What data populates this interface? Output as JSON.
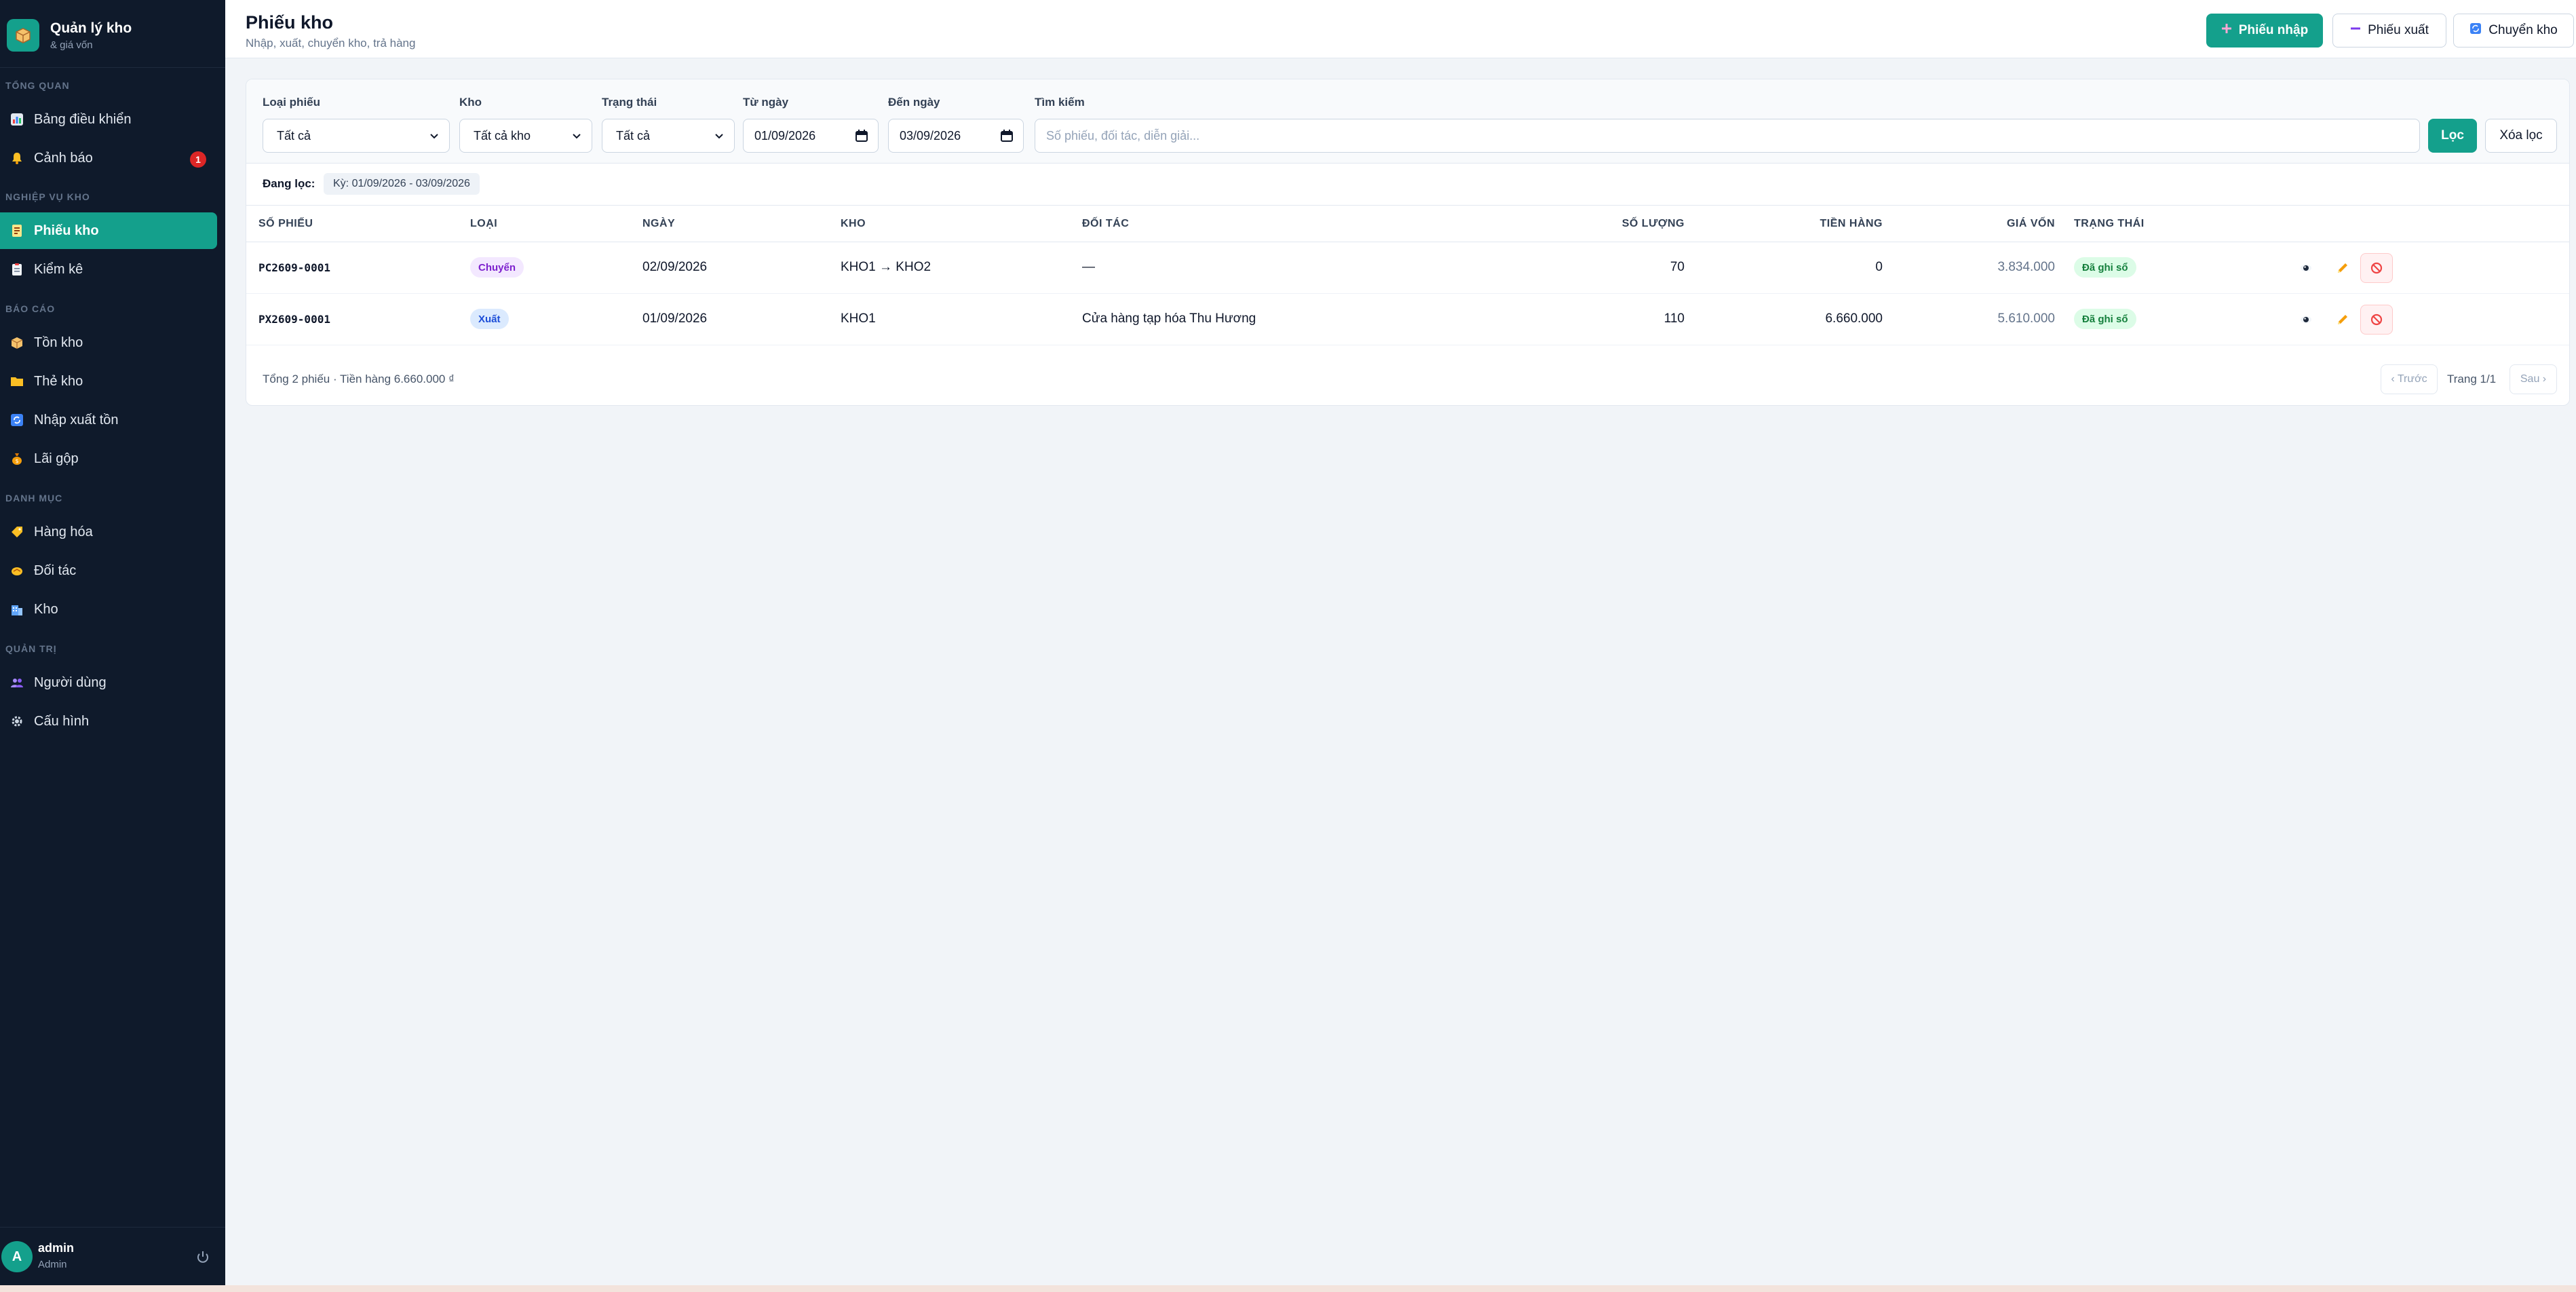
{
  "brand": {
    "title": "Quản lý kho",
    "subtitle": "& giá vốn"
  },
  "sidebar": {
    "sections": [
      {
        "label": "TỔNG QUAN"
      },
      {
        "label": "NGHIỆP VỤ KHO"
      },
      {
        "label": "BÁO CÁO"
      },
      {
        "label": "DANH MỤC"
      },
      {
        "label": "QUẢN TRỊ"
      }
    ],
    "items": [
      {
        "label": "Bảng điều khiển",
        "icon": "chart-icon"
      },
      {
        "label": "Cảnh báo",
        "icon": "bell-icon",
        "badge": "1"
      },
      {
        "label": "Phiếu kho",
        "icon": "receipt-icon",
        "active": true
      },
      {
        "label": "Kiểm kê",
        "icon": "clipboard-icon"
      },
      {
        "label": "Tồn kho",
        "icon": "box-icon"
      },
      {
        "label": "Thẻ kho",
        "icon": "folder-icon"
      },
      {
        "label": "Nhập xuất tồn",
        "icon": "refresh-icon"
      },
      {
        "label": "Lãi gộp",
        "icon": "money-bag-icon"
      },
      {
        "label": "Hàng hóa",
        "icon": "tag-icon"
      },
      {
        "label": "Đối tác",
        "icon": "handshake-icon"
      },
      {
        "label": "Kho",
        "icon": "building-icon"
      },
      {
        "label": "Người dùng",
        "icon": "users-icon"
      },
      {
        "label": "Cấu hình",
        "icon": "gear-icon"
      }
    ],
    "user": {
      "initial": "A",
      "name": "admin",
      "role": "Admin"
    }
  },
  "header": {
    "title": "Phiếu kho",
    "subtitle": "Nhập, xuất, chuyển kho, trả hàng",
    "buttons": {
      "import": "Phiếu nhập",
      "export": "Phiếu xuất",
      "transfer": "Chuyển kho"
    }
  },
  "filters": {
    "type": {
      "label": "Loại phiếu",
      "value": "Tất cả"
    },
    "warehouse": {
      "label": "Kho",
      "value": "Tất cả kho"
    },
    "status": {
      "label": "Trạng thái",
      "value": "Tất cả"
    },
    "from": {
      "label": "Từ ngày",
      "value": "01/09/2026"
    },
    "to": {
      "label": "Đến ngày",
      "value": "03/09/2026"
    },
    "search": {
      "label": "Tìm kiếm",
      "placeholder": "Số phiếu, đối tác, diễn giải..."
    },
    "apply_label": "Lọc",
    "clear_label": "Xóa lọc",
    "active_label": "Đang lọc:",
    "active_chip": "Kỳ: 01/09/2026 - 03/09/2026"
  },
  "table": {
    "columns": [
      "SỐ PHIẾU",
      "LOẠI",
      "NGÀY",
      "KHO",
      "ĐỐI TÁC",
      "SỐ LƯỢNG",
      "TIỀN HÀNG",
      "GIÁ VỐN",
      "TRẠNG THÁI"
    ],
    "rows": [
      {
        "code": "PC2609-0001",
        "type": "Chuyển",
        "date": "02/09/2026",
        "warehouse": "KHO1 → KHO2",
        "partner": "—",
        "qty": "70",
        "amount": "0",
        "cost": "3.834.000",
        "status": "Đã ghi sổ"
      },
      {
        "code": "PX2609-0001",
        "type": "Xuất",
        "date": "01/09/2026",
        "warehouse": "KHO1",
        "partner": "Cửa hàng tạp hóa Thu Hương",
        "qty": "110",
        "amount": "6.660.000",
        "cost": "5.610.000",
        "status": "Đã ghi sổ"
      }
    ]
  },
  "footer": {
    "summary": "Tổng 2 phiếu · Tiền hàng 6.660.000 ₫",
    "prev": "‹ Trước",
    "page": "Trang 1/1",
    "next": "Sau ›"
  },
  "colors": {
    "accent": "#14a08c",
    "sidebar": "#0f1a2b",
    "transfer_pill": "#f3e8ff",
    "export_pill": "#dbeafe",
    "status_pill": "#dcfce7"
  }
}
